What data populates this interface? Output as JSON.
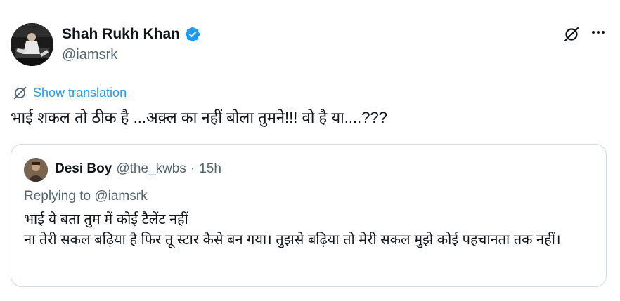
{
  "tweet": {
    "author": {
      "name": "Shah Rukh Khan",
      "handle": "@iamsrk",
      "verified": true
    },
    "icons": {
      "verified": "verified-badge-icon",
      "grok": "grok-icon",
      "more": "more-dots-icon",
      "translate": "translate-icon"
    },
    "translate_label": "Show translation",
    "text": "भाई शकल तो ठीक है ...अक़्ल का नहीं बोला तुमने!!! वो है या....???"
  },
  "quote": {
    "author": {
      "name": "Desi Boy",
      "handle": "@the_kwbs",
      "separator": "·",
      "time": "15h"
    },
    "replying_prefix": "Replying to",
    "replying_handle": "@iamsrk",
    "lines": [
      "भाई ये बता तुम में कोई टैलेंट नहीं",
      "ना तेरी सकल बढ़िया है फिर तू स्टार कैसे बन गया। तुझसे बढ़िया तो मेरी सकल मुझे कोई पहचानता तक नहीं।"
    ]
  },
  "colors": {
    "link": "#1d9bf0",
    "secondary": "#536471",
    "text": "#0f1419",
    "border": "#cfd9de"
  }
}
